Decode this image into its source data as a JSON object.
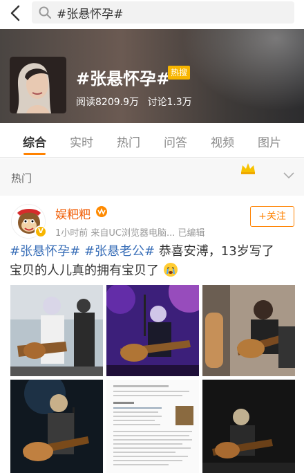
{
  "search": {
    "query": "#张悬怀孕#"
  },
  "header": {
    "title": "#张悬怀孕#",
    "badge": "热搜",
    "reads": "阅读8209.9万",
    "discussions": "讨论1.3万"
  },
  "tabs": [
    "综合",
    "实时",
    "热门",
    "问答",
    "视频",
    "图片"
  ],
  "section": {
    "label": "热门"
  },
  "post": {
    "username": "娱粑粑",
    "meta": "1小时前  来自UC浏览器电脑...  已编辑",
    "follow": "+关注",
    "tag1": "#张悬怀孕#",
    "tag2": "#张悬老公#",
    "text_line1_tail": " 恭喜安溥，13岁写了",
    "text_line2": "宝贝的人儿真的拥有宝贝了"
  },
  "colors": {
    "accent": "#ff8200",
    "link": "#3a6fb8",
    "username": "#f05a00",
    "badge": "#f7b500"
  }
}
